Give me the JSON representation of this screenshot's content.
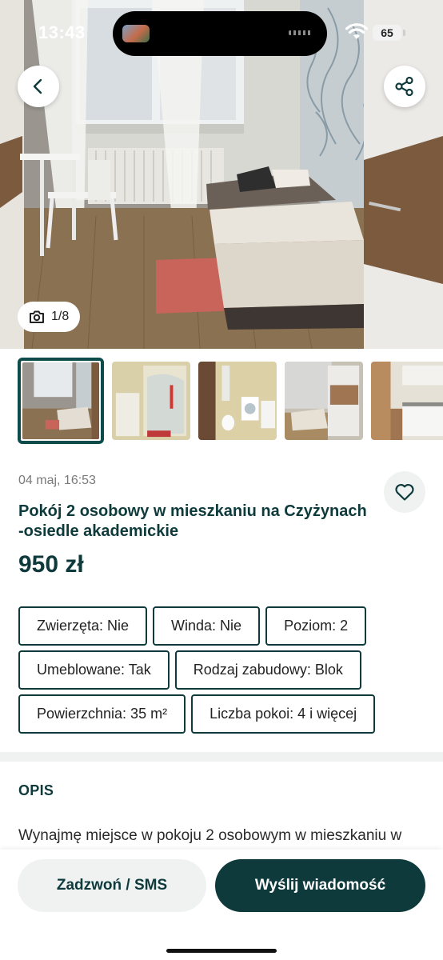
{
  "status_bar": {
    "time": "13:43",
    "battery": "65",
    "wifi_icon": "wifi-icon"
  },
  "gallery": {
    "counter": "1/8",
    "counter_icon": "camera-icon",
    "thumbnails": [
      {
        "subject": "bedroom"
      },
      {
        "subject": "shower"
      },
      {
        "subject": "bathroom"
      },
      {
        "subject": "bedroom-wardrobe"
      },
      {
        "subject": "kitchen"
      }
    ]
  },
  "nav": {
    "back_icon": "chevron-left-icon",
    "share_icon": "share-icon"
  },
  "listing": {
    "date": "04 maj, 16:53",
    "title": "Pokój 2 osobowy  w mieszkaniu na Czyżynach -osiedle akademickie",
    "price": "950 zł",
    "favorite_icon": "heart-icon",
    "attributes": [
      [
        "Zwierzęta: Nie",
        "Winda: Nie",
        "Poziom: 2"
      ],
      [
        "Umeblowane: Tak",
        "Rodzaj zabudowy: Blok"
      ],
      [
        "Powierzchnia: 35 m²",
        "Liczba pokoi: 4 i więcej"
      ]
    ]
  },
  "description": {
    "heading": "OPIS",
    "text": "Wynajmę miejsce w pokoju 2 osobowym w mieszkaniu w"
  },
  "actions": {
    "call_label": "Zadzwoń / SMS",
    "message_label": "Wyślij wiadomość"
  },
  "colors": {
    "brand": "#0e3a3c",
    "chip_border": "#0e3a3c",
    "muted_bg": "#f0f2f2"
  }
}
